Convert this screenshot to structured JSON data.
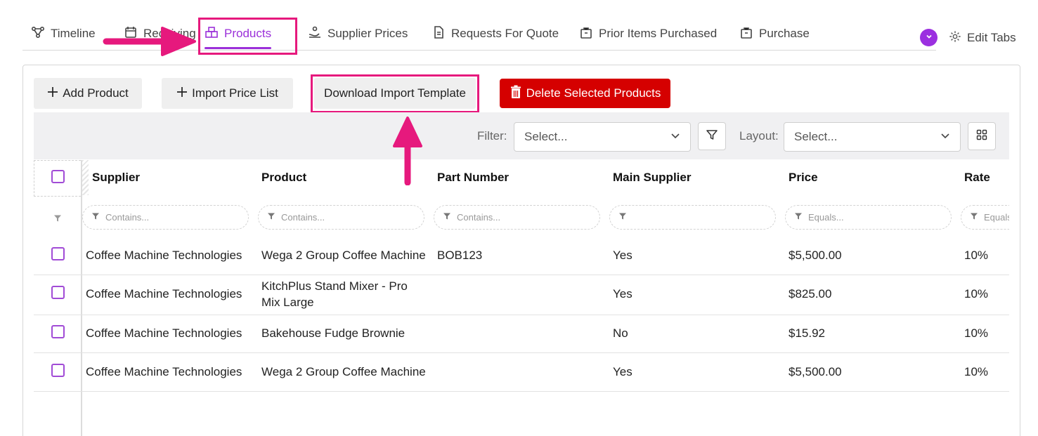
{
  "tabs": [
    {
      "label": "Timeline",
      "icon": "timeline-icon"
    },
    {
      "label": "Receiving",
      "icon": "receiving-icon"
    },
    {
      "label": "Products",
      "icon": "products-icon",
      "active": true
    },
    {
      "label": "Supplier Prices",
      "icon": "supplier-prices-icon"
    },
    {
      "label": "Requests For Quote",
      "icon": "document-icon"
    },
    {
      "label": "Prior Items Purchased",
      "icon": "bag-icon"
    },
    {
      "label": "Purchase",
      "icon": "bag-icon"
    }
  ],
  "edit_tabs_label": "Edit Tabs",
  "toolbar": {
    "add_product": "Add Product",
    "import_price_list": "Import Price List",
    "download_template": "Download Import Template",
    "delete_selected": "Delete Selected Products",
    "filter_label": "Filter:",
    "filter_placeholder": "Select...",
    "layout_label": "Layout:",
    "layout_placeholder": "Select..."
  },
  "grid": {
    "columns": [
      "Supplier",
      "Product",
      "Part Number",
      "Main Supplier",
      "Price",
      "Rate"
    ],
    "filter_placeholders": [
      "Contains...",
      "Contains...",
      "Contains...",
      "",
      "Equals...",
      "Equals..."
    ],
    "rows": [
      {
        "supplier": "Coffee Machine Technologies",
        "product": "Wega 2 Group Coffee Machine",
        "part_number": "BOB123",
        "main_supplier": "Yes",
        "price": "$5,500.00",
        "rate": "10%"
      },
      {
        "supplier": "Coffee Machine Technologies",
        "product": "KitchPlus Stand Mixer - Pro Mix Large",
        "part_number": "",
        "main_supplier": "Yes",
        "price": "$825.00",
        "rate": "10%"
      },
      {
        "supplier": "Coffee Machine Technologies",
        "product": "Bakehouse Fudge Brownie",
        "part_number": "",
        "main_supplier": "No",
        "price": "$15.92",
        "rate": "10%"
      },
      {
        "supplier": "Coffee Machine Technologies",
        "product": "Wega 2 Group Coffee Machine",
        "part_number": "",
        "main_supplier": "Yes",
        "price": "$5,500.00",
        "rate": "10%"
      }
    ]
  },
  "colors": {
    "accent": "#9b30d9",
    "delete": "#d50000",
    "annotation": "#e6197d"
  }
}
